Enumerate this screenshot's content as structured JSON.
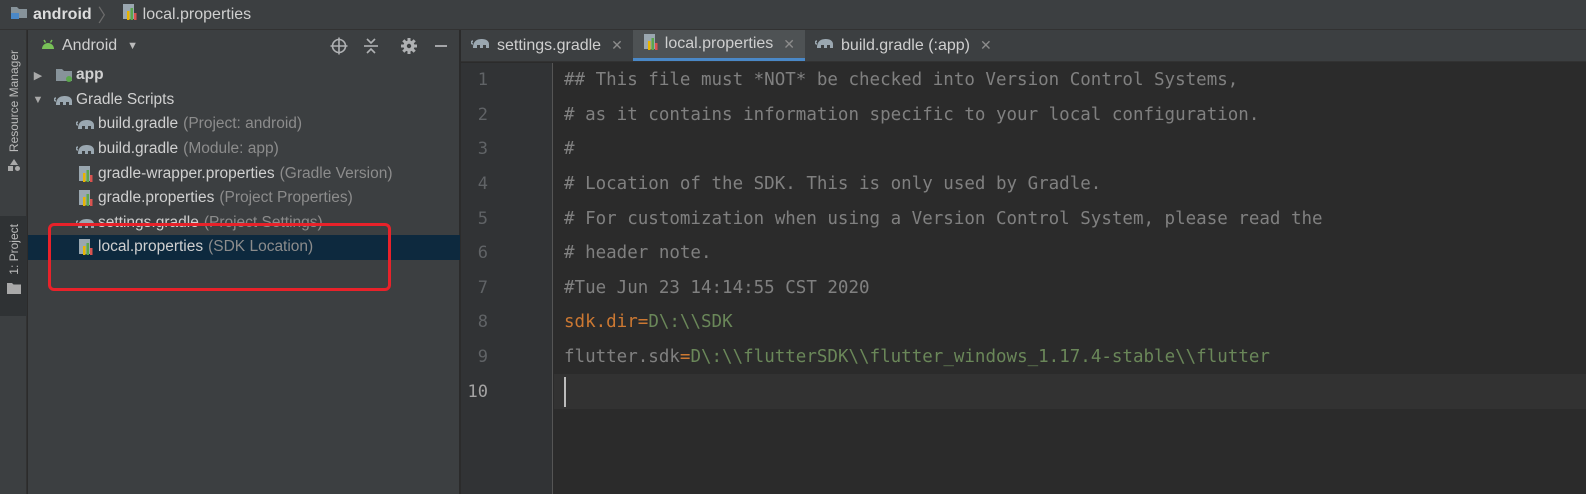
{
  "breadcrumb": {
    "root": "android",
    "file": "local.properties"
  },
  "toolstrip": {
    "resource_manager": "Resource Manager",
    "project": "1: Project"
  },
  "project_panel": {
    "view_label": "Android",
    "tree": [
      {
        "name": "app",
        "hint": "",
        "icon": "module-folder-icon",
        "level": 0,
        "arrow": "▶",
        "bold": true
      },
      {
        "name": "Gradle Scripts",
        "hint": "",
        "icon": "gradle-elephant-icon",
        "level": 0,
        "arrow": "▼",
        "bold": false
      },
      {
        "name": "build.gradle",
        "hint": "(Project: android)",
        "icon": "gradle-elephant-icon",
        "level": 1
      },
      {
        "name": "build.gradle",
        "hint": "(Module: app)",
        "icon": "gradle-elephant-icon",
        "level": 1
      },
      {
        "name": "gradle-wrapper.properties",
        "hint": "(Gradle Version)",
        "icon": "properties-file-icon",
        "level": 1
      },
      {
        "name": "gradle.properties",
        "hint": "(Project Properties)",
        "icon": "properties-file-icon",
        "level": 1
      },
      {
        "name": "settings.gradle",
        "hint": "(Project Settings)",
        "icon": "gradle-elephant-icon",
        "level": 1
      },
      {
        "name": "local.properties",
        "hint": "(SDK Location)",
        "icon": "properties-file-icon",
        "level": 1,
        "selected": true
      }
    ]
  },
  "editor": {
    "tabs": [
      {
        "label": "settings.gradle",
        "icon": "gradle-elephant-icon",
        "active": false
      },
      {
        "label": "local.properties",
        "icon": "properties-file-icon",
        "active": true
      },
      {
        "label": "build.gradle (:app)",
        "icon": "gradle-elephant-icon",
        "active": false
      }
    ],
    "line_numbers": [
      "1",
      "2",
      "3",
      "4",
      "5",
      "6",
      "7",
      "8",
      "9",
      "10"
    ],
    "lines": [
      [
        {
          "t": "## This file must *NOT* be checked into Version Control Systems,",
          "c": "comment"
        }
      ],
      [
        {
          "t": "# as it contains information specific to your local configuration.",
          "c": "comment"
        }
      ],
      [
        {
          "t": "#",
          "c": "comment"
        }
      ],
      [
        {
          "t": "# Location of the SDK. This is only used by Gradle.",
          "c": "comment"
        }
      ],
      [
        {
          "t": "# For customization when using a Version Control System, please read the",
          "c": "comment"
        }
      ],
      [
        {
          "t": "# header note.",
          "c": "comment"
        }
      ],
      [
        {
          "t": "#Tue Jun 23 14:14:55 CST 2020",
          "c": "comment"
        }
      ],
      [
        {
          "t": "sdk.dir",
          "c": "key"
        },
        {
          "t": "=",
          "c": "eq"
        },
        {
          "t": "D\\:\\\\SDK",
          "c": "val"
        }
      ],
      [
        {
          "t": "flutter.sdk",
          "c": "comment"
        },
        {
          "t": "=",
          "c": "eq"
        },
        {
          "t": "D\\:\\\\flutterSDK\\\\flutter_windows_1.17.4-stable\\\\flutter",
          "c": "val"
        }
      ],
      []
    ],
    "current_line": 10
  },
  "colors": {
    "accent": "#4a88c7",
    "highlight_box": "#e8222a",
    "selection": "#0d293e"
  }
}
